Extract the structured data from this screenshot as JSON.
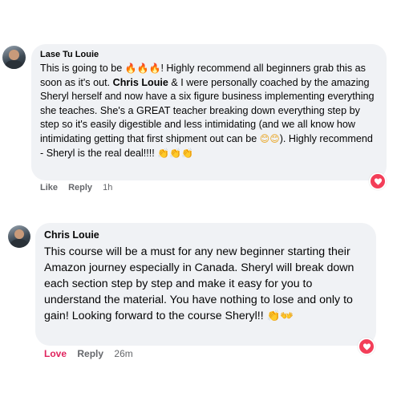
{
  "comments": [
    {
      "author": "Lase Tu Louie",
      "text_a": "This is going to be ",
      "emoji_fire": "🔥🔥🔥",
      "text_b": "! Highly recommend all beginners grab this as soon as it's out. ",
      "mention": "Chris Louie",
      "text_c": " & I were personally coached by the amazing Sheryl herself and now have a six figure business implementing everything she teaches. She's a GREAT teacher breaking down everything step by step so it's easily digestible and less intimidating (and we all know how intimidating getting that first shipment out can be ",
      "emoji_smile": "😊😊",
      "text_d": "). Highly recommend - Sheryl is the real deal!!!! ",
      "emoji_clap": "👏👏👏",
      "like_label": "Like",
      "reply_label": "Reply",
      "timestamp": "1h",
      "reaction_icon": "heart-icon",
      "reaction_color": "#f33e58"
    },
    {
      "author": "Chris Louie",
      "text_a": "This course will be a must for any new beginner starting their Amazon journey especially in Canada. Sheryl will break down each section step by step and make it easy for you to understand the material. You have nothing to lose and only to gain! Looking forward to the course Sheryl!! ",
      "emoji_clap": "👏👐",
      "like_label": "Love",
      "reply_label": "Reply",
      "timestamp": "26m",
      "reaction_icon": "heart-icon",
      "reaction_color": "#f33e58"
    }
  ]
}
